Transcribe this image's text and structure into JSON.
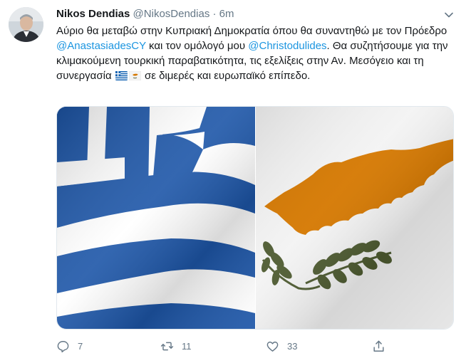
{
  "tweet": {
    "author_name": "Nikos Dendias",
    "handle": "@NikosDendias",
    "separator": "·",
    "time": "6m",
    "text_1": "Αύριο θα μεταβώ στην Κυπριακή Δημοκρατία όπου θα συναντηθώ με τον Πρόεδρο ",
    "mention_1": "@AnastasiadesCY",
    "text_2": " και τον ομόλογό μου ",
    "mention_2": "@Christodulides",
    "text_3": ". Θα συζητήσουμε για την κλιμακούμενη τουρκική παραβατικότητα, τις εξελίξεις στην Αν. Μεσόγειο και τη συνεργασία ",
    "text_4": " σε διμερές και ευρωπαϊκό επίπεδο.",
    "emoji_1": "greece-flag-icon",
    "emoji_2": "cyprus-flag-icon"
  },
  "media": {
    "left_image": "greece-flag",
    "right_image": "cyprus-flag"
  },
  "actions": {
    "reply_count": "7",
    "retweet_count": "11",
    "like_count": "33"
  },
  "colors": {
    "mention": "#1b95e0",
    "greek_blue": "#0d5eaf",
    "cyprus_orange": "#d57800",
    "olive_green": "#4e5b31"
  }
}
